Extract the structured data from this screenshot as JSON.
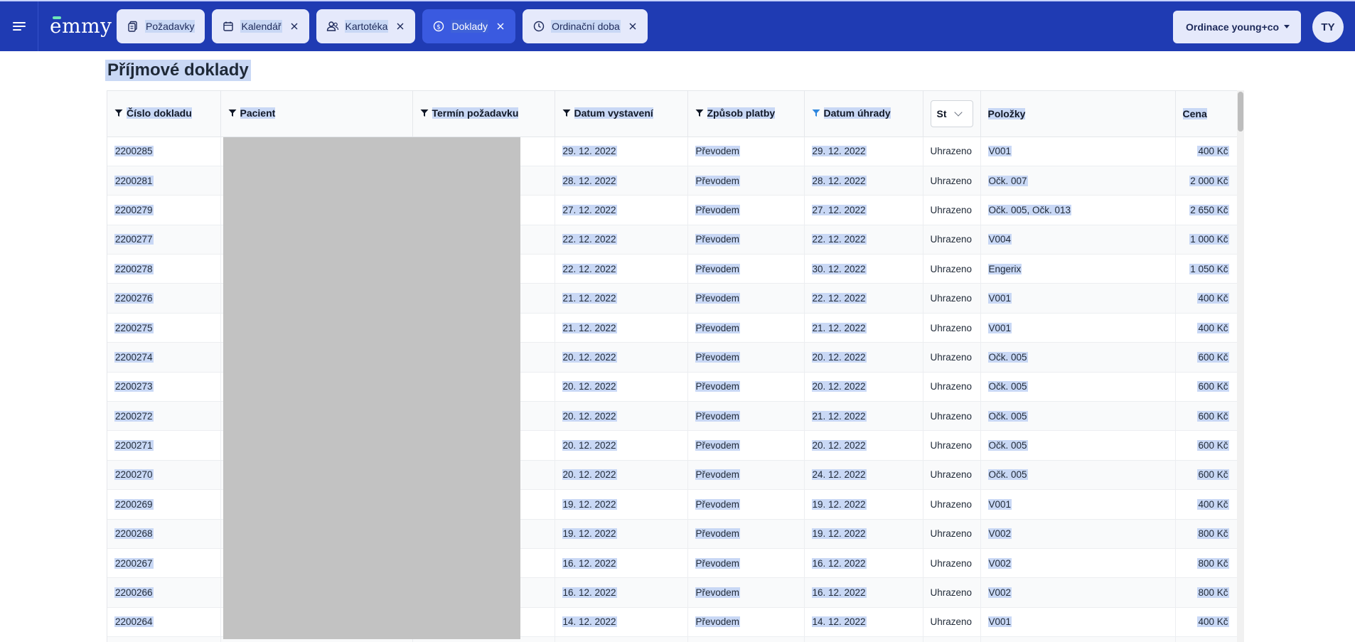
{
  "app": {
    "logo_text": "emmy"
  },
  "tabs": [
    {
      "label": "Požadavky",
      "icon": "documents-icon",
      "closable": false
    },
    {
      "label": "Kalendář",
      "icon": "calendar-icon",
      "closable": true
    },
    {
      "label": "Kartotéka",
      "icon": "users-icon",
      "closable": true
    },
    {
      "label": "Doklady",
      "icon": "dollar-circle-icon",
      "closable": true,
      "active": true
    },
    {
      "label": "Ordinační doba",
      "icon": "clock-icon",
      "closable": true
    }
  ],
  "header": {
    "org_select": "Ordinace young+co",
    "avatar_initials": "TY"
  },
  "page": {
    "title": "Příjmové doklady"
  },
  "table": {
    "columns": {
      "cislo": "Číslo dokladu",
      "pacient": "Pacient",
      "termin": "Termín požadavku",
      "vystaveni": "Datum vystavení",
      "zpusob": "Způsob platby",
      "uhrada": "Datum úhrady",
      "stav": "St",
      "polozky": "Položky",
      "cena": "Cena"
    },
    "rows": [
      {
        "cislo": "2200285",
        "vystaveni": "29. 12. 2022",
        "zpusob": "Převodem",
        "uhrada": "29. 12. 2022",
        "stav": "Uhrazeno",
        "polozky": "V001",
        "cena": "400 Kč"
      },
      {
        "cislo": "2200281",
        "vystaveni": "28. 12. 2022",
        "zpusob": "Převodem",
        "uhrada": "28. 12. 2022",
        "stav": "Uhrazeno",
        "polozky": "Očk. 007",
        "cena": "2 000 Kč"
      },
      {
        "cislo": "2200279",
        "vystaveni": "27. 12. 2022",
        "zpusob": "Převodem",
        "uhrada": "27. 12. 2022",
        "stav": "Uhrazeno",
        "polozky": "Očk. 005, Očk. 013",
        "cena": "2 650 Kč"
      },
      {
        "cislo": "2200277",
        "vystaveni": "22. 12. 2022",
        "zpusob": "Převodem",
        "uhrada": "22. 12. 2022",
        "stav": "Uhrazeno",
        "polozky": "V004",
        "cena": "1 000 Kč"
      },
      {
        "cislo": "2200278",
        "vystaveni": "22. 12. 2022",
        "zpusob": "Převodem",
        "uhrada": "30. 12. 2022",
        "stav": "Uhrazeno",
        "polozky": "Engerix",
        "cena": "1 050 Kč"
      },
      {
        "cislo": "2200276",
        "vystaveni": "21. 12. 2022",
        "zpusob": "Převodem",
        "uhrada": "22. 12. 2022",
        "stav": "Uhrazeno",
        "polozky": "V001",
        "cena": "400 Kč"
      },
      {
        "cislo": "2200275",
        "vystaveni": "21. 12. 2022",
        "zpusob": "Převodem",
        "uhrada": "21. 12. 2022",
        "stav": "Uhrazeno",
        "polozky": "V001",
        "cena": "400 Kč"
      },
      {
        "cislo": "2200274",
        "vystaveni": "20. 12. 2022",
        "zpusob": "Převodem",
        "uhrada": "20. 12. 2022",
        "stav": "Uhrazeno",
        "polozky": "Očk. 005",
        "cena": "600 Kč"
      },
      {
        "cislo": "2200273",
        "vystaveni": "20. 12. 2022",
        "zpusob": "Převodem",
        "uhrada": "20. 12. 2022",
        "stav": "Uhrazeno",
        "polozky": "Očk. 005",
        "cena": "600 Kč"
      },
      {
        "cislo": "2200272",
        "vystaveni": "20. 12. 2022",
        "zpusob": "Převodem",
        "uhrada": "21. 12. 2022",
        "stav": "Uhrazeno",
        "polozky": "Očk. 005",
        "cena": "600 Kč"
      },
      {
        "cislo": "2200271",
        "vystaveni": "20. 12. 2022",
        "zpusob": "Převodem",
        "uhrada": "20. 12. 2022",
        "stav": "Uhrazeno",
        "polozky": "Očk. 005",
        "cena": "600 Kč"
      },
      {
        "cislo": "2200270",
        "vystaveni": "20. 12. 2022",
        "zpusob": "Převodem",
        "uhrada": "24. 12. 2022",
        "stav": "Uhrazeno",
        "polozky": "Očk. 005",
        "cena": "600 Kč"
      },
      {
        "cislo": "2200269",
        "vystaveni": "19. 12. 2022",
        "zpusob": "Převodem",
        "uhrada": "19. 12. 2022",
        "stav": "Uhrazeno",
        "polozky": "V001",
        "cena": "400 Kč"
      },
      {
        "cislo": "2200268",
        "vystaveni": "19. 12. 2022",
        "zpusob": "Převodem",
        "uhrada": "19. 12. 2022",
        "stav": "Uhrazeno",
        "polozky": "V002",
        "cena": "800 Kč"
      },
      {
        "cislo": "2200267",
        "vystaveni": "16. 12. 2022",
        "zpusob": "Převodem",
        "uhrada": "16. 12. 2022",
        "stav": "Uhrazeno",
        "polozky": "V002",
        "cena": "800 Kč"
      },
      {
        "cislo": "2200266",
        "vystaveni": "16. 12. 2022",
        "zpusob": "Převodem",
        "uhrada": "16. 12. 2022",
        "stav": "Uhrazeno",
        "polozky": "V002",
        "cena": "800 Kč"
      },
      {
        "cislo": "2200264",
        "vystaveni": "14. 12. 2022",
        "zpusob": "Převodem",
        "uhrada": "14. 12. 2022",
        "stav": "Uhrazeno",
        "polozky": "V001",
        "cena": "400 Kč"
      },
      {
        "cislo": "",
        "vystaveni": "",
        "zpusob": "",
        "uhrada": "",
        "stav": "",
        "polozky": "",
        "cena": ""
      }
    ]
  },
  "colors": {
    "topbar": "#1f3bb3",
    "tab_bg": "#e5e9fb",
    "tab_active": "#3a5ae0",
    "selection": "#c9d8f5",
    "filter_active": "#2e86de"
  }
}
